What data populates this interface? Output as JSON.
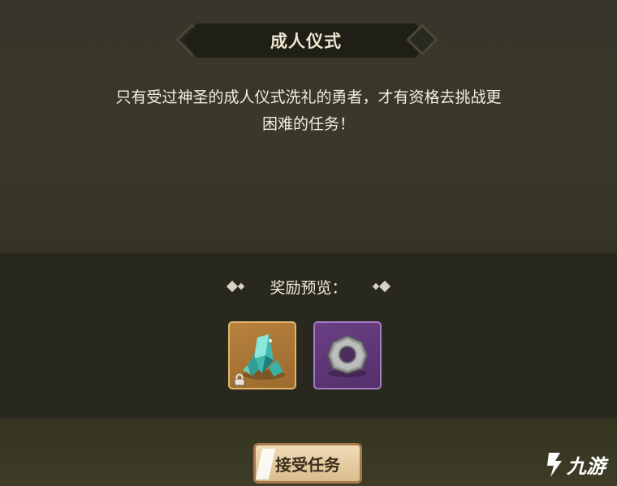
{
  "dialog": {
    "title": "成人仪式",
    "description_line1": "只有受过神圣的成人仪式洗礼的勇者，才有资格去挑战更",
    "description_line2": "困难的任务！"
  },
  "rewards": {
    "label": "奖励预览：",
    "items": [
      {
        "icon": "crystal-icon",
        "frame_color": "#b8823e",
        "locked": true
      },
      {
        "icon": "stone-ring-icon",
        "frame_color": "#6a3f84",
        "locked": false
      }
    ]
  },
  "actions": {
    "accept_label": "接受任务"
  },
  "watermark": {
    "text": "九游",
    "logo": "jiuyou-logo-icon"
  }
}
